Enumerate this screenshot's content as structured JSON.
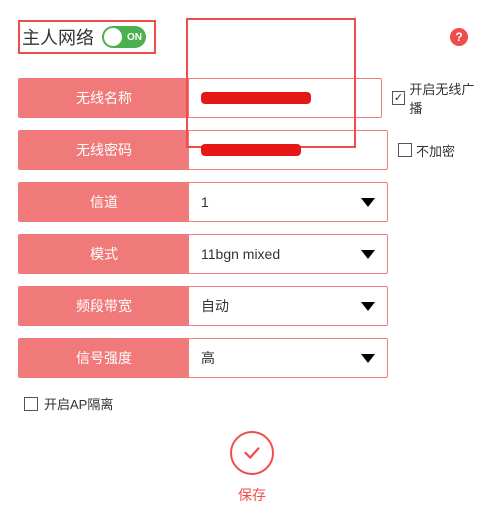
{
  "header": {
    "title": "主人网络",
    "toggle_label": "ON"
  },
  "help_icon": "?",
  "fields": {
    "ssid": {
      "label": "无线名称"
    },
    "password": {
      "label": "无线密码"
    },
    "channel": {
      "label": "信道",
      "value": "1"
    },
    "mode": {
      "label": "模式",
      "value": "11bgn mixed"
    },
    "bandwidth": {
      "label": "频段带宽",
      "value": "自动"
    },
    "signal": {
      "label": "信号强度",
      "value": "高"
    }
  },
  "checkboxes": {
    "broadcast": {
      "label": "开启无线广播",
      "checked": "✓"
    },
    "no_encrypt": {
      "label": "不加密"
    },
    "ap_isolation": {
      "label": "开启AP隔离"
    }
  },
  "save": {
    "label": "保存"
  }
}
